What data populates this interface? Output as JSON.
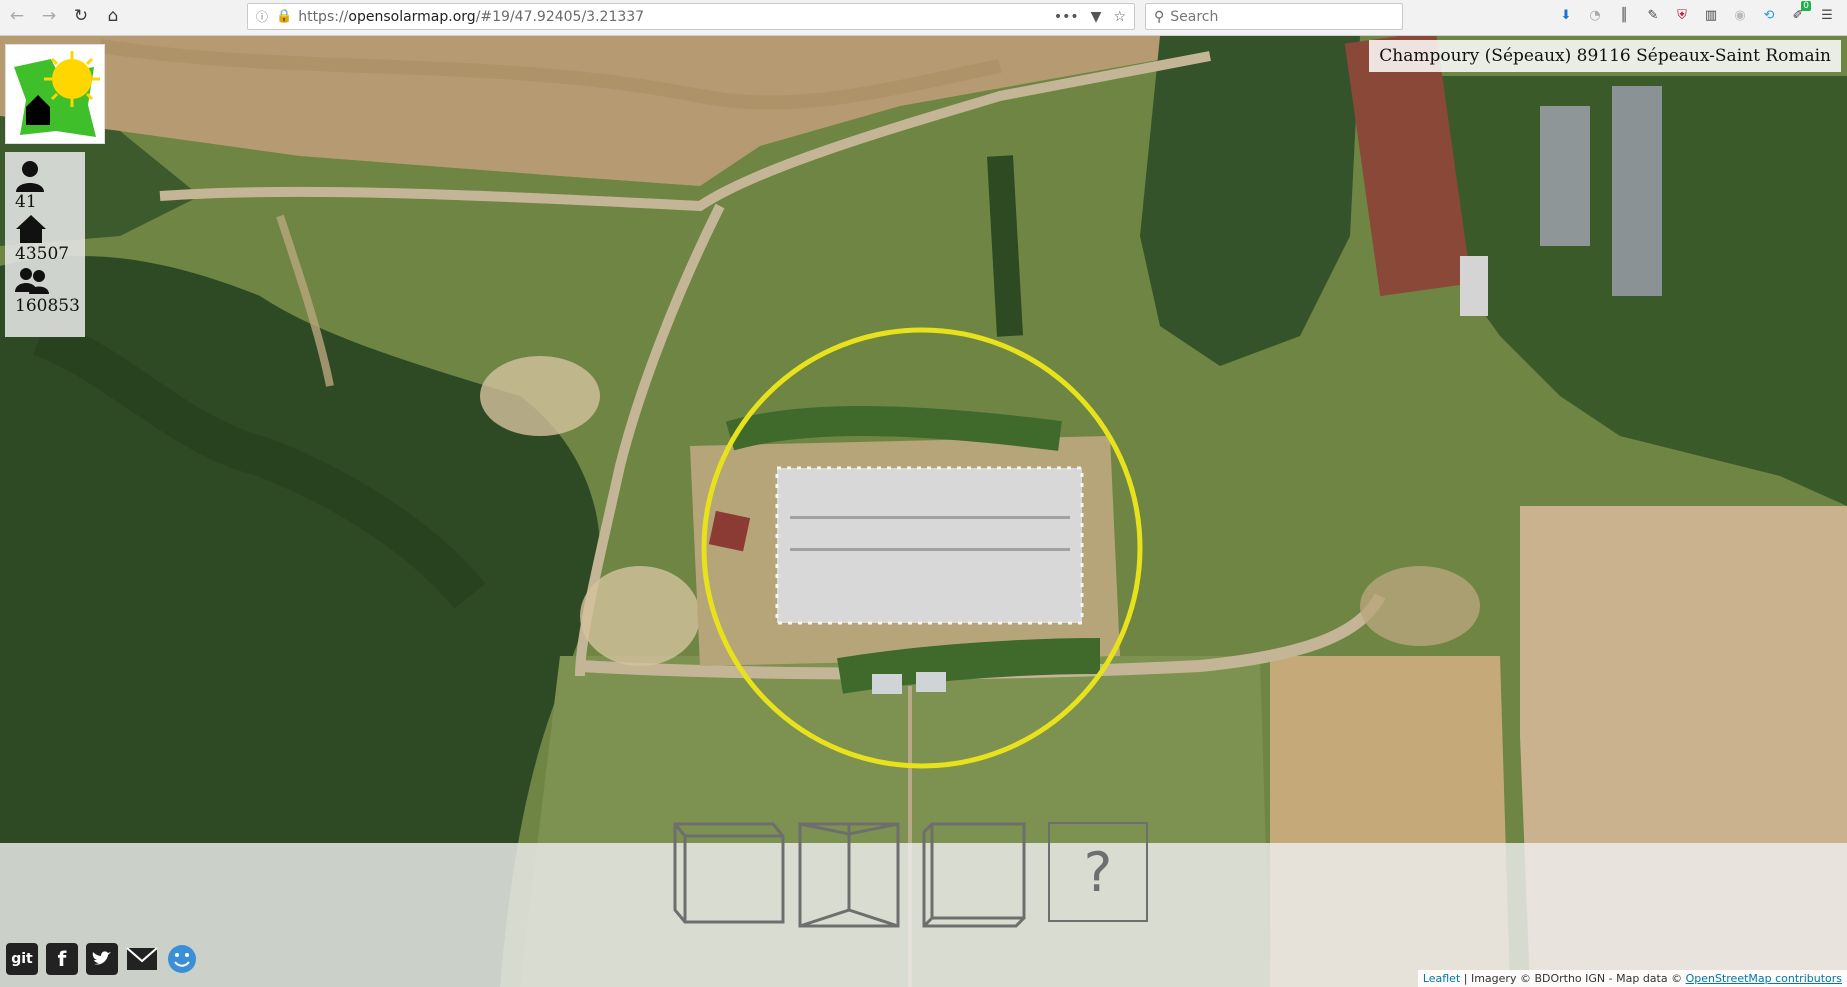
{
  "browser": {
    "url_prefix": "https://",
    "url_host": "opensolarmap.org",
    "url_path": "/#19/47.92405/3.21337",
    "search_placeholder": "Search",
    "more_label": "•••",
    "badge_count": "0"
  },
  "stats": {
    "users": "41",
    "buildings": "43507",
    "contributions": "160853"
  },
  "address": "Champoury (Sépeaux) 89116 Sépeaux-Saint Romain",
  "orientation_buttons": {
    "help_label": "?"
  },
  "share": {
    "git_label": "git",
    "facebook_label": "f"
  },
  "attribution": {
    "leaflet": "Leaflet",
    "imagery": " | Imagery © BDOrtho IGN - Map data © ",
    "osm": "OpenStreetMap contributors"
  },
  "colors": {
    "highlight_circle": "#e8e21c",
    "forest": "#2e4a25",
    "field_tan": "#c9b28f",
    "grass": "#6f8544",
    "roof": "#d8d8d8"
  }
}
